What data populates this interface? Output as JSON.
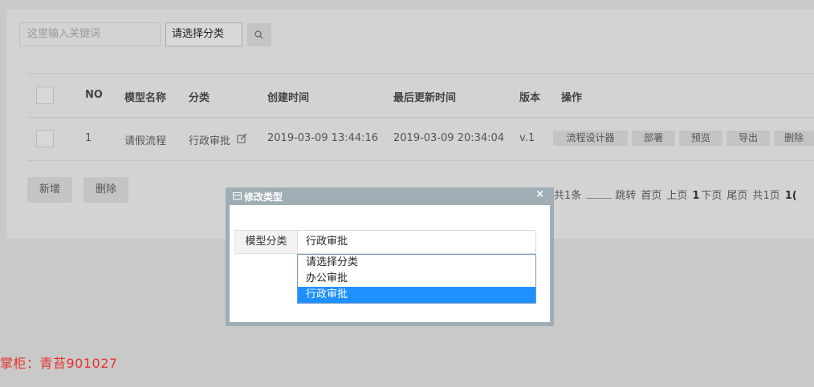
{
  "toolbar": {
    "search_placeholder": "这里输入关键词",
    "category_select": "请选择分类"
  },
  "table": {
    "headers": [
      "NO",
      "模型名称",
      "分类",
      "创建时间",
      "最后更新时间",
      "版本",
      "操作"
    ],
    "rows": [
      {
        "no": "1",
        "name": "请假流程",
        "category": "行政审批",
        "created": "2019-03-09 13:44:16",
        "updated": "2019-03-09 20:34:04",
        "version": "v.1",
        "actions": [
          "流程设计器",
          "部署",
          "预览",
          "导出",
          "删除"
        ]
      }
    ]
  },
  "buttons": {
    "add": "新增",
    "delete": "删除"
  },
  "pager": {
    "total": "共1条",
    "jump": "跳转",
    "first": "首页",
    "prev": "上页",
    "current": "1",
    "next": "下页",
    "last": "尾页",
    "pages": "共1页",
    "size_partial": "1("
  },
  "modal": {
    "title": "修改类型",
    "close": "×",
    "field_label": "模型分类",
    "field_value": "行政审批",
    "options": [
      {
        "label": "请选择分类",
        "selected": false
      },
      {
        "label": "办公审批",
        "selected": false
      },
      {
        "label": "行政审批",
        "selected": true
      }
    ]
  },
  "watermark": "掌柜：青苔901027",
  "colors": {
    "selected_option": "#1e90ff",
    "watermark": "#e8322e",
    "modal_header": "#9fadb5"
  }
}
